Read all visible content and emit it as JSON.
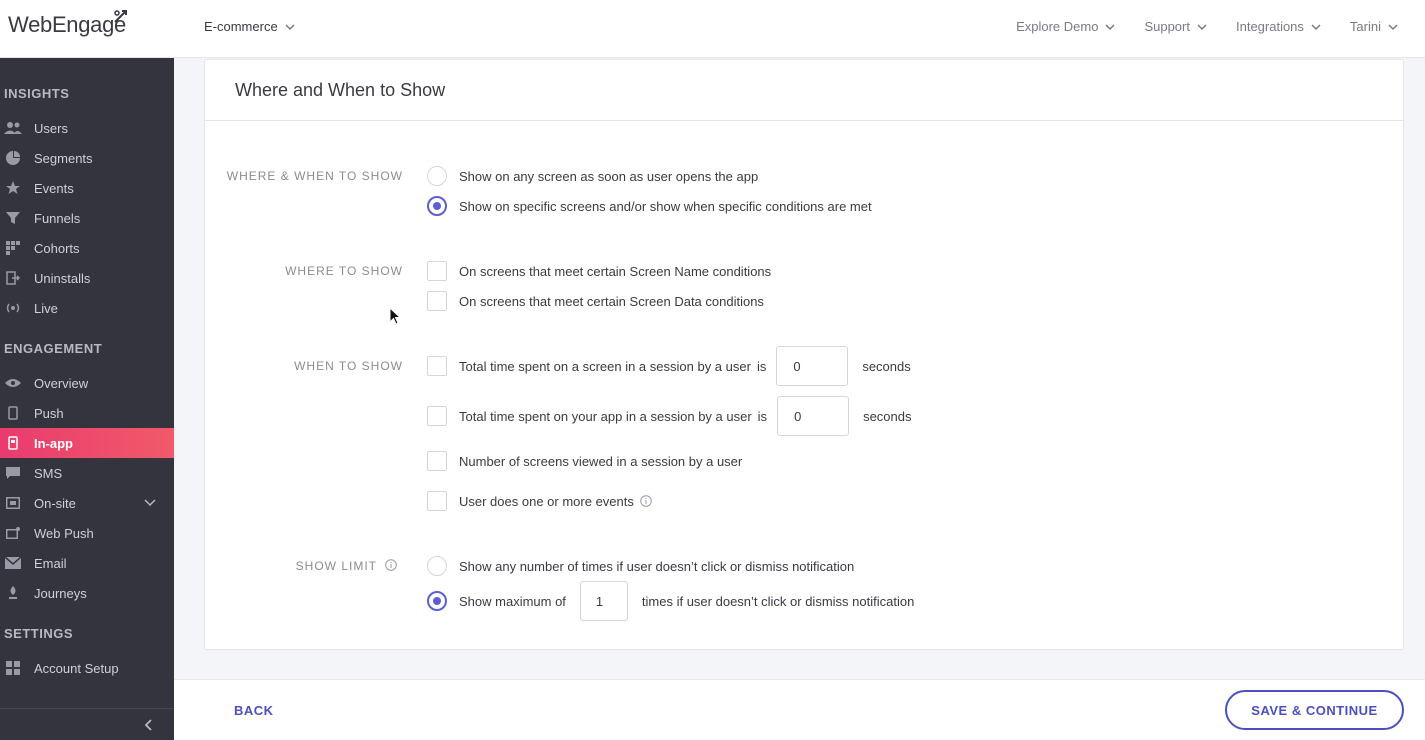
{
  "header": {
    "logo_text": "WebEngage",
    "project": "E-commerce",
    "nav": [
      "Explore Demo",
      "Support",
      "Integrations",
      "Tarini"
    ]
  },
  "sidebar": {
    "sections": [
      {
        "title": "INSIGHTS",
        "items": [
          {
            "label": "Users",
            "icon": "users-icon"
          },
          {
            "label": "Segments",
            "icon": "pie-icon"
          },
          {
            "label": "Events",
            "icon": "star-icon"
          },
          {
            "label": "Funnels",
            "icon": "funnel-icon"
          },
          {
            "label": "Cohorts",
            "icon": "grid-icon"
          },
          {
            "label": "Uninstalls",
            "icon": "exit-icon"
          },
          {
            "label": "Live",
            "icon": "broadcast-icon"
          }
        ]
      },
      {
        "title": "ENGAGEMENT",
        "items": [
          {
            "label": "Overview",
            "icon": "eye-icon"
          },
          {
            "label": "Push",
            "icon": "phone-icon"
          },
          {
            "label": "In-app",
            "icon": "inapp-icon",
            "active": true
          },
          {
            "label": "SMS",
            "icon": "sms-icon"
          },
          {
            "label": "On-site",
            "icon": "onsite-icon",
            "expandable": true
          },
          {
            "label": "Web Push",
            "icon": "webpush-icon"
          },
          {
            "label": "Email",
            "icon": "email-icon"
          },
          {
            "label": "Journeys",
            "icon": "journeys-icon"
          }
        ]
      },
      {
        "title": "SETTINGS",
        "items": [
          {
            "label": "Account Setup",
            "icon": "account-icon"
          }
        ]
      }
    ]
  },
  "card": {
    "title": "Where and When to Show",
    "where_when": {
      "label": "WHERE & WHEN TO SHOW",
      "options": [
        {
          "text": "Show on any screen as soon as user opens the app",
          "selected": false
        },
        {
          "text": "Show on specific screens and/or show when specific conditions are met",
          "selected": true
        }
      ]
    },
    "where": {
      "label": "WHERE TO SHOW",
      "options": [
        {
          "text": "On screens that meet certain Screen Name conditions",
          "checked": false
        },
        {
          "text": "On screens that meet certain Screen Data conditions",
          "checked": false
        }
      ]
    },
    "when": {
      "label": "WHEN TO SHOW",
      "screen_time": {
        "text": "Total time spent on a screen in a session by a user",
        "is": "is",
        "value": "0",
        "unit": "seconds"
      },
      "app_time": {
        "text": "Total time spent on your app in a session by a user",
        "is": "is",
        "value": "0",
        "unit": "seconds"
      },
      "screens_viewed": "Number of screens viewed in a session by a user",
      "events": "User does one or more events"
    },
    "show_limit": {
      "label": "SHOW LIMIT",
      "any": "Show any number of times if user doesn’t click or dismiss notification",
      "max_prefix": "Show maximum of",
      "max_value": "1",
      "max_suffix": "times if user doesn’t click or dismiss notification",
      "selected": "max"
    }
  },
  "footer": {
    "back": "BACK",
    "save": "SAVE & CONTINUE"
  },
  "colors": {
    "accent": "#5b5fcf",
    "sidebar_bg": "#34343f",
    "active_item": "#e93b6e"
  }
}
